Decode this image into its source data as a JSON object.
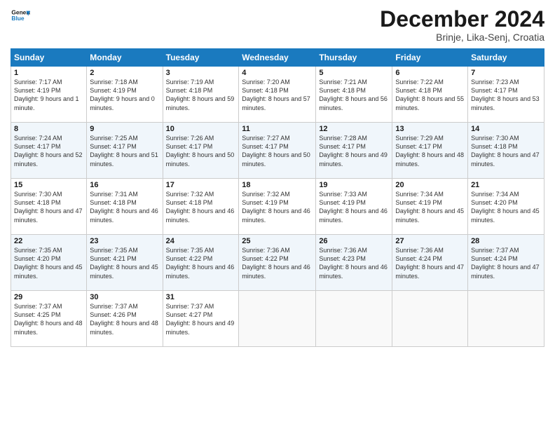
{
  "logo": {
    "line1": "General",
    "line2": "Blue"
  },
  "title": "December 2024",
  "subtitle": "Brinje, Lika-Senj, Croatia",
  "weekdays": [
    "Sunday",
    "Monday",
    "Tuesday",
    "Wednesday",
    "Thursday",
    "Friday",
    "Saturday"
  ],
  "weeks": [
    [
      {
        "day": "1",
        "sunrise": "7:17 AM",
        "sunset": "4:19 PM",
        "daylight": "9 hours and 1 minute."
      },
      {
        "day": "2",
        "sunrise": "7:18 AM",
        "sunset": "4:19 PM",
        "daylight": "9 hours and 0 minutes."
      },
      {
        "day": "3",
        "sunrise": "7:19 AM",
        "sunset": "4:18 PM",
        "daylight": "8 hours and 59 minutes."
      },
      {
        "day": "4",
        "sunrise": "7:20 AM",
        "sunset": "4:18 PM",
        "daylight": "8 hours and 57 minutes."
      },
      {
        "day": "5",
        "sunrise": "7:21 AM",
        "sunset": "4:18 PM",
        "daylight": "8 hours and 56 minutes."
      },
      {
        "day": "6",
        "sunrise": "7:22 AM",
        "sunset": "4:18 PM",
        "daylight": "8 hours and 55 minutes."
      },
      {
        "day": "7",
        "sunrise": "7:23 AM",
        "sunset": "4:17 PM",
        "daylight": "8 hours and 53 minutes."
      }
    ],
    [
      {
        "day": "8",
        "sunrise": "7:24 AM",
        "sunset": "4:17 PM",
        "daylight": "8 hours and 52 minutes."
      },
      {
        "day": "9",
        "sunrise": "7:25 AM",
        "sunset": "4:17 PM",
        "daylight": "8 hours and 51 minutes."
      },
      {
        "day": "10",
        "sunrise": "7:26 AM",
        "sunset": "4:17 PM",
        "daylight": "8 hours and 50 minutes."
      },
      {
        "day": "11",
        "sunrise": "7:27 AM",
        "sunset": "4:17 PM",
        "daylight": "8 hours and 50 minutes."
      },
      {
        "day": "12",
        "sunrise": "7:28 AM",
        "sunset": "4:17 PM",
        "daylight": "8 hours and 49 minutes."
      },
      {
        "day": "13",
        "sunrise": "7:29 AM",
        "sunset": "4:17 PM",
        "daylight": "8 hours and 48 minutes."
      },
      {
        "day": "14",
        "sunrise": "7:30 AM",
        "sunset": "4:18 PM",
        "daylight": "8 hours and 47 minutes."
      }
    ],
    [
      {
        "day": "15",
        "sunrise": "7:30 AM",
        "sunset": "4:18 PM",
        "daylight": "8 hours and 47 minutes."
      },
      {
        "day": "16",
        "sunrise": "7:31 AM",
        "sunset": "4:18 PM",
        "daylight": "8 hours and 46 minutes."
      },
      {
        "day": "17",
        "sunrise": "7:32 AM",
        "sunset": "4:18 PM",
        "daylight": "8 hours and 46 minutes."
      },
      {
        "day": "18",
        "sunrise": "7:32 AM",
        "sunset": "4:19 PM",
        "daylight": "8 hours and 46 minutes."
      },
      {
        "day": "19",
        "sunrise": "7:33 AM",
        "sunset": "4:19 PM",
        "daylight": "8 hours and 46 minutes."
      },
      {
        "day": "20",
        "sunrise": "7:34 AM",
        "sunset": "4:19 PM",
        "daylight": "8 hours and 45 minutes."
      },
      {
        "day": "21",
        "sunrise": "7:34 AM",
        "sunset": "4:20 PM",
        "daylight": "8 hours and 45 minutes."
      }
    ],
    [
      {
        "day": "22",
        "sunrise": "7:35 AM",
        "sunset": "4:20 PM",
        "daylight": "8 hours and 45 minutes."
      },
      {
        "day": "23",
        "sunrise": "7:35 AM",
        "sunset": "4:21 PM",
        "daylight": "8 hours and 45 minutes."
      },
      {
        "day": "24",
        "sunrise": "7:35 AM",
        "sunset": "4:22 PM",
        "daylight": "8 hours and 46 minutes."
      },
      {
        "day": "25",
        "sunrise": "7:36 AM",
        "sunset": "4:22 PM",
        "daylight": "8 hours and 46 minutes."
      },
      {
        "day": "26",
        "sunrise": "7:36 AM",
        "sunset": "4:23 PM",
        "daylight": "8 hours and 46 minutes."
      },
      {
        "day": "27",
        "sunrise": "7:36 AM",
        "sunset": "4:24 PM",
        "daylight": "8 hours and 47 minutes."
      },
      {
        "day": "28",
        "sunrise": "7:37 AM",
        "sunset": "4:24 PM",
        "daylight": "8 hours and 47 minutes."
      }
    ],
    [
      {
        "day": "29",
        "sunrise": "7:37 AM",
        "sunset": "4:25 PM",
        "daylight": "8 hours and 48 minutes."
      },
      {
        "day": "30",
        "sunrise": "7:37 AM",
        "sunset": "4:26 PM",
        "daylight": "8 hours and 48 minutes."
      },
      {
        "day": "31",
        "sunrise": "7:37 AM",
        "sunset": "4:27 PM",
        "daylight": "8 hours and 49 minutes."
      },
      null,
      null,
      null,
      null
    ]
  ]
}
